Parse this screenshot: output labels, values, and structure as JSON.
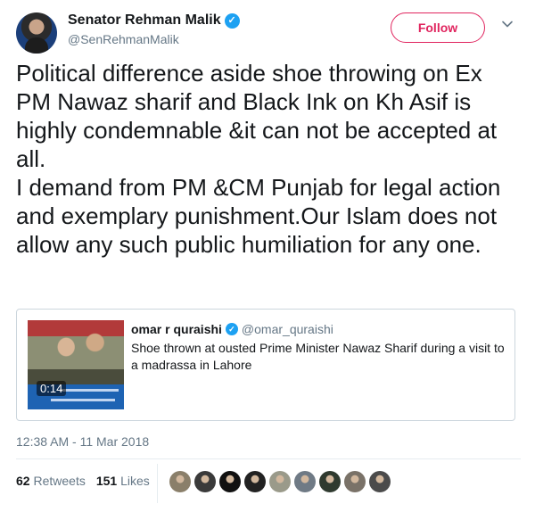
{
  "author": {
    "name": "Senator Rehman Malik",
    "handle": "@SenRehmanMalik",
    "verified_mark": "✓"
  },
  "follow_label": "Follow",
  "tweet_text": "Political difference aside shoe throwing on Ex PM Nawaz sharif and Black Ink on Kh Asif is highly condemnable &it can not be accepted at all.\n I demand from PM &CM Punjab for legal action and exemplary punishment.Our Islam does not allow any such public humiliation for any one.",
  "quote": {
    "name": "omar r quraishi",
    "handle": "@omar_quraishi",
    "verified_mark": "✓",
    "text": "Shoe thrown at ousted Prime Minister Nawaz Sharif during a visit to a madrassa in Lahore",
    "video_duration": "0:14"
  },
  "timestamp": "12:38 AM - 11 Mar 2018",
  "stats": {
    "retweets_count": "62",
    "retweets_label": "Retweets",
    "likes_count": "151",
    "likes_label": "Likes"
  },
  "likers": [
    {
      "icon": "avatar-icon",
      "color": "#8a7f6a"
    },
    {
      "icon": "avatar-icon",
      "color": "#3a3a3a"
    },
    {
      "icon": "avatar-icon",
      "color": "#111111"
    },
    {
      "icon": "avatar-icon",
      "color": "#222222"
    },
    {
      "icon": "avatar-icon",
      "color": "#9a9a8a"
    },
    {
      "icon": "avatar-icon",
      "color": "#6f7a85"
    },
    {
      "icon": "avatar-icon",
      "color": "#2f3a2f"
    },
    {
      "icon": "avatar-icon",
      "color": "#7a7268"
    },
    {
      "icon": "avatar-icon",
      "color": "#4b4b4b"
    }
  ],
  "colors": {
    "accent": "#1da1f2",
    "follow": "#e0245e",
    "muted": "#657786"
  }
}
